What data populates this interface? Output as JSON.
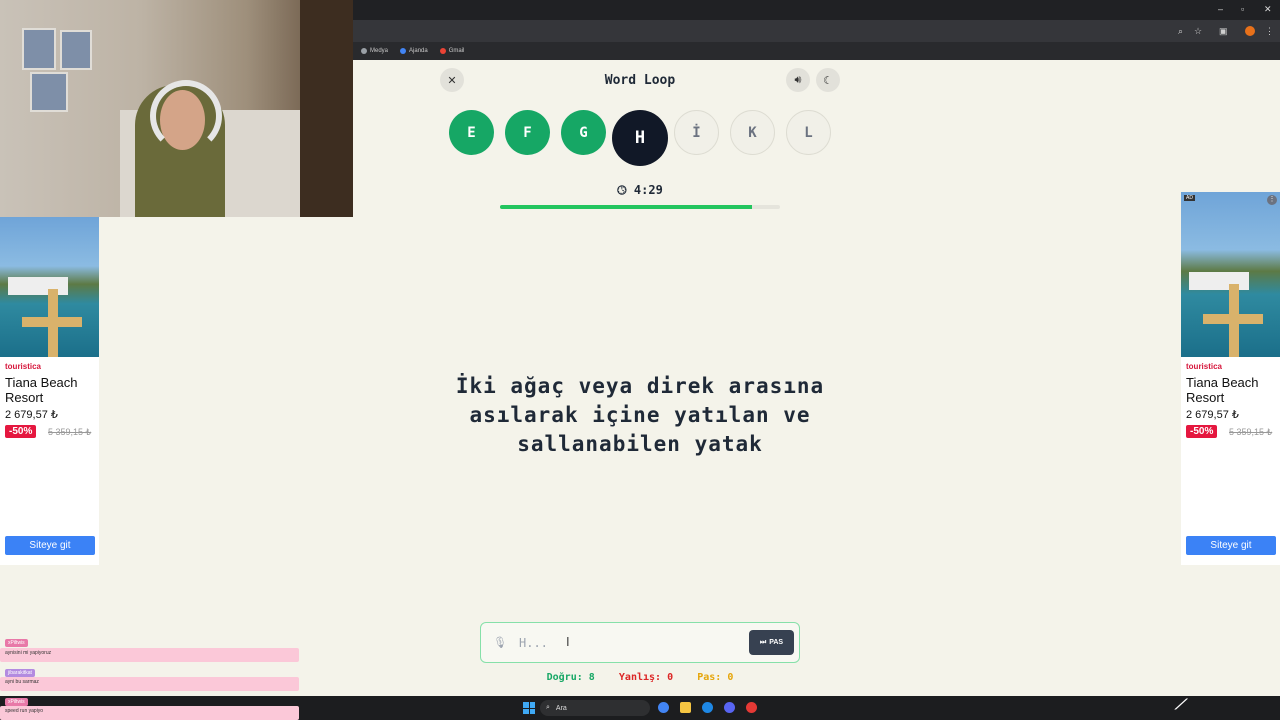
{
  "browser": {
    "bookmarks": [
      {
        "label": "Medya",
        "color": "#9aa0a6"
      },
      {
        "label": "Ajanda",
        "color": "#4285f4"
      },
      {
        "label": "Gmail",
        "color": "#ea4335"
      }
    ]
  },
  "game": {
    "title": "Word Loop",
    "letters": [
      {
        "letter": "E",
        "state": "done"
      },
      {
        "letter": "F",
        "state": "done"
      },
      {
        "letter": "G",
        "state": "done"
      },
      {
        "letter": "H",
        "state": "current"
      },
      {
        "letter": "İ",
        "state": "todo"
      },
      {
        "letter": "K",
        "state": "todo"
      },
      {
        "letter": "L",
        "state": "todo"
      }
    ],
    "timer": "4:29",
    "progress_fraction": 0.9,
    "clue_lines": [
      "İki ağaç veya direk arasına",
      "asılarak içine yatılan ve",
      "sallanabilen yatak"
    ],
    "input_placeholder": "H...",
    "pass_label": "PAS",
    "scores": {
      "correct_label": "Doğru:",
      "correct": "8",
      "wrong_label": "Yanlış:",
      "wrong": "0",
      "pass_label": "Pas:",
      "pass": "0"
    },
    "colors": {
      "correct": "#16a765",
      "wrong": "#dc2626",
      "pass": "#e5a50a",
      "accent": "#16a765"
    }
  },
  "ads": [
    {
      "brand": "touristica",
      "title": "Tiana Beach Resort",
      "price": "2 679,57 ₺",
      "discount": "-50%",
      "old_price": "5 359,15 ₺",
      "cta": "Siteye git"
    },
    {
      "badge": "AD",
      "brand": "touristica",
      "title": "Tiana Beach Resort",
      "price": "2 679,57 ₺",
      "discount": "-50%",
      "old_price": "5 359,15 ₺",
      "cta": "Siteye git"
    }
  ],
  "chat": [
    {
      "user": "xPiltwis",
      "text": "aynisini mi yapiyoruz",
      "color": "#e879a8"
    },
    {
      "user": "jibarakitkat",
      "text": "ayni bu sarmaz",
      "color": "#b38be0"
    },
    {
      "user": "xPiltwis",
      "text": "speed run yapiyo",
      "color": "#e879a8"
    }
  ],
  "taskbar": {
    "search_label": "Ara"
  }
}
